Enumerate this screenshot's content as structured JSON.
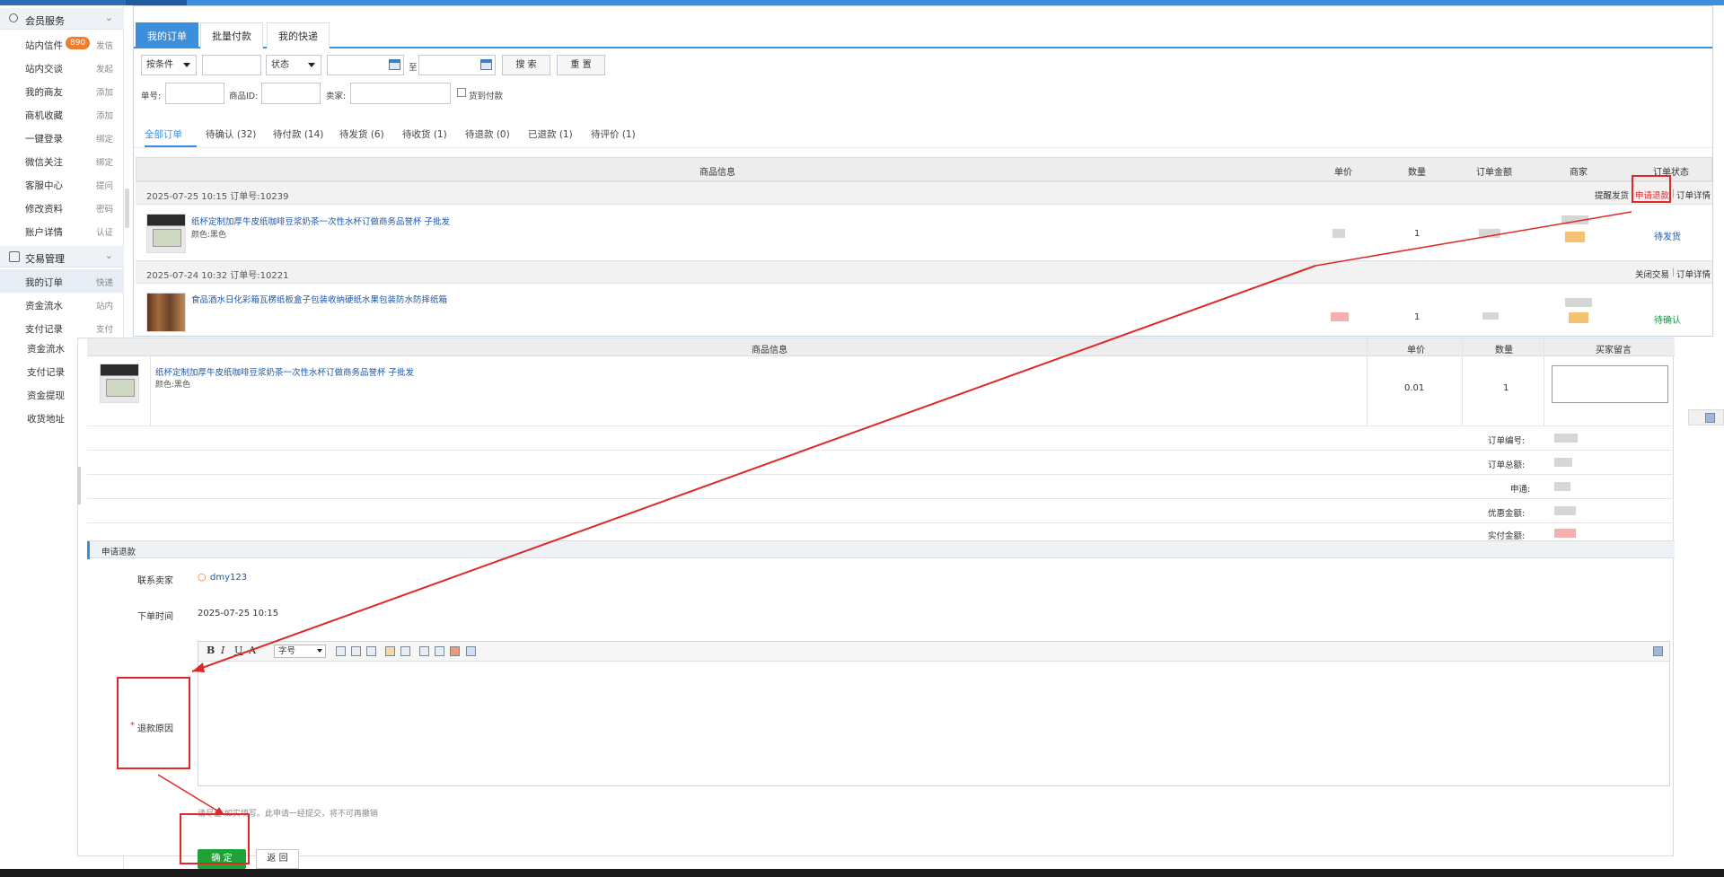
{
  "sidebar": {
    "member_group": "会员服务",
    "member_items": [
      {
        "label": "站内信件",
        "action": "发信",
        "badge": "890"
      },
      {
        "label": "站内交谈",
        "action": "发起"
      },
      {
        "label": "我的商友",
        "action": "添加"
      },
      {
        "label": "商机收藏",
        "action": "添加"
      },
      {
        "label": "一键登录",
        "action": "绑定"
      },
      {
        "label": "微信关注",
        "action": "绑定"
      },
      {
        "label": "客服中心",
        "action": "提问"
      },
      {
        "label": "修改资料",
        "action": "密码"
      },
      {
        "label": "账户详情",
        "action": "认证"
      }
    ],
    "trade_group": "交易管理",
    "trade_items": [
      {
        "label": "我的订单",
        "action": "快递"
      },
      {
        "label": "资金流水",
        "action": "站内"
      },
      {
        "label": "支付记录",
        "action": "支付"
      }
    ],
    "sub_items": [
      "资金流水",
      "支付记录",
      "资金提现",
      "收货地址"
    ]
  },
  "top_tabs": [
    "我的订单",
    "批量付款",
    "我的快递"
  ],
  "filters": {
    "condition_select": "按条件",
    "status_select": "状态",
    "to_label": "至",
    "search_btn": "搜 索",
    "reset_btn": "重 置",
    "order_no_label": "单号:",
    "goods_id_label": "商品ID:",
    "seller_label": "卖家:",
    "guarantee_label": "货到付款"
  },
  "order_tabs": [
    "全部订单",
    "待确认 (32)",
    "待付款 (14)",
    "待发货 (6)",
    "待收货 (1)",
    "待退款 (0)",
    "已退款 (1)",
    "待评价 (1)"
  ],
  "table_headers": [
    "商品信息",
    "单价",
    "数量",
    "订单金额",
    "商家",
    "订单状态"
  ],
  "orders": [
    {
      "header_text": "2025-07-25 10:15   订单号:10239",
      "actions": [
        "提醒发货",
        "申请退款",
        "订单详情"
      ],
      "separators": [
        "|",
        "|"
      ],
      "title": "纸杯定制加厚牛皮纸咖啡豆浆奶茶一次性水杯订做商务品誉杯 子批发",
      "attr": "颜色:黑色",
      "qty": "1",
      "status": "待发货"
    },
    {
      "header_text": "2025-07-24 10:32   订单号:10221",
      "actions": [
        "关闭交易",
        "订单详情"
      ],
      "separators": [
        "|"
      ],
      "title": "食品酒水日化彩箱瓦楞纸板盒子包装收纳硬纸水果包装防水防摔纸箱",
      "attr": "",
      "qty": "1",
      "status": "待确认"
    }
  ],
  "refund": {
    "headers": [
      "商品信息",
      "单价",
      "数量",
      "买家留言"
    ],
    "title": "纸杯定制加厚牛皮纸咖啡豆浆奶茶一次性水杯订做商务品誉杯 子批发",
    "attr": "颜色:黑色",
    "price": "0.01",
    "qty": "1",
    "summary_labels": [
      "订单编号:",
      "订单总额:",
      "申通:",
      "优惠金额:",
      "实付金额:"
    ],
    "section_title": "申请退款",
    "contact_label": "联系卖家",
    "contact_value": "dmy123",
    "time_label": "下单时间",
    "time_value": "2025-07-25 10:15",
    "font_size_select": "字号",
    "reason_required": "*",
    "reason_label": "退款原因",
    "note": "请尽量  如实填写。此申请一经提交，将不可再撤销",
    "ok_btn": "确 定",
    "back_btn": "返 回"
  },
  "colors": {
    "accent": "#3b8fdc",
    "annotation_red": "#e02828",
    "ok_green": "#1fa339",
    "badge_orange": "#f07b2a"
  }
}
